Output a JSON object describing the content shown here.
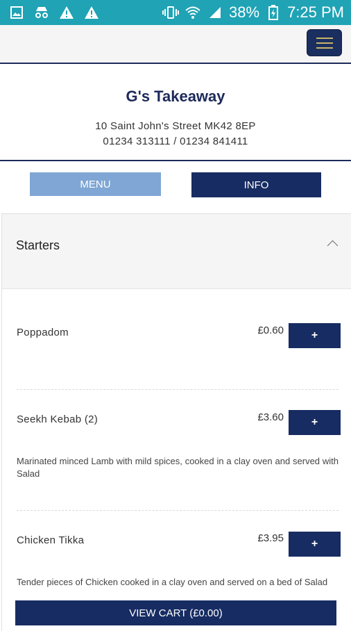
{
  "status_bar": {
    "battery": "38%",
    "time": "7:25 PM",
    "left_icons": [
      "image-icon",
      "incognito-icon",
      "warning-icon",
      "warning-icon"
    ],
    "right_icons": [
      "vibrate-icon",
      "wifi-icon",
      "signal-icon",
      "battery-charging-icon"
    ]
  },
  "header": {
    "title": "G's Takeaway",
    "address": "10 Saint John's Street MK42 8EP",
    "phones": "01234 313111 / 01234 841411"
  },
  "tabs": {
    "menu_label": "MENU",
    "info_label": "INFO"
  },
  "section": {
    "title": "Starters"
  },
  "items": [
    {
      "name": "Poppadom",
      "price": "£0.60",
      "add_label": "+"
    },
    {
      "name": "Seekh Kebab (2)",
      "price": "£3.60",
      "add_label": "+",
      "description": "Marinated minced Lamb with mild spices, cooked in a clay oven and served with Salad"
    },
    {
      "name": "Chicken Tikka",
      "price": "£3.95",
      "add_label": "+",
      "description": "Tender pieces of Chicken cooked in a clay oven and served on a bed of Salad"
    }
  ],
  "cart": {
    "label": "VIEW CART (£0.00)"
  },
  "colors": {
    "status_bar": "#1fa3b5",
    "primary": "#172c62",
    "menu_tab": "#7fa6d4",
    "title": "#1d2a5a"
  }
}
